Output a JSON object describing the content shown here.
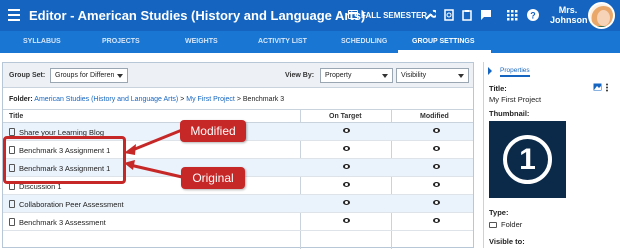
{
  "app": {
    "title": "Editor - American Studies (History and Language Arts)",
    "semester": "FALL SEMESTER",
    "user_name": "Mrs. Johnson"
  },
  "nav": {
    "tabs": [
      "SYLLABUS",
      "PROJECTS",
      "WEIGHTS",
      "ACTIVITY LIST",
      "SCHEDULING",
      "GROUP SETTINGS"
    ],
    "active": "GROUP SETTINGS"
  },
  "filters": {
    "group_set_label": "Group Set:",
    "group_set_value": "Groups for Differen",
    "view_by_label": "View By:",
    "view_by_value": "Property",
    "visibility_value": "Visibility"
  },
  "folder": {
    "label": "Folder:",
    "course_link": "American Studies (History and Language Arts)",
    "sep1": ">",
    "project_link": "My First Project",
    "sep2": ">",
    "current": "Benchmark 3"
  },
  "table": {
    "headers": {
      "title": "Title",
      "on_target": "On Target",
      "modified": "Modified"
    },
    "rows": [
      {
        "name": "Share your Learning Blog"
      },
      {
        "name": "Benchmark 3 Assignment 1"
      },
      {
        "name": "Benchmark 3 Assignment 1"
      },
      {
        "name": "Discussion 1"
      },
      {
        "name": "Collaboration Peer Assessment"
      },
      {
        "name": "Benchmark 3 Assessment"
      }
    ]
  },
  "annotations": {
    "modified": "Modified",
    "original": "Original"
  },
  "properties": {
    "tab": "Properties",
    "title_label": "Title:",
    "title_value": "My First Project",
    "thumbnail_label": "Thumbnail:",
    "thumbnail_number": "1",
    "type_label": "Type:",
    "type_value": "Folder",
    "visible_label": "Visible to:"
  },
  "colors": {
    "header_blue": "#1565c0",
    "nav_blue": "#1976d2",
    "annotation_red": "#c62828",
    "row_alt": "#eaf2fb",
    "thumb_bg": "#0b2a4a"
  }
}
